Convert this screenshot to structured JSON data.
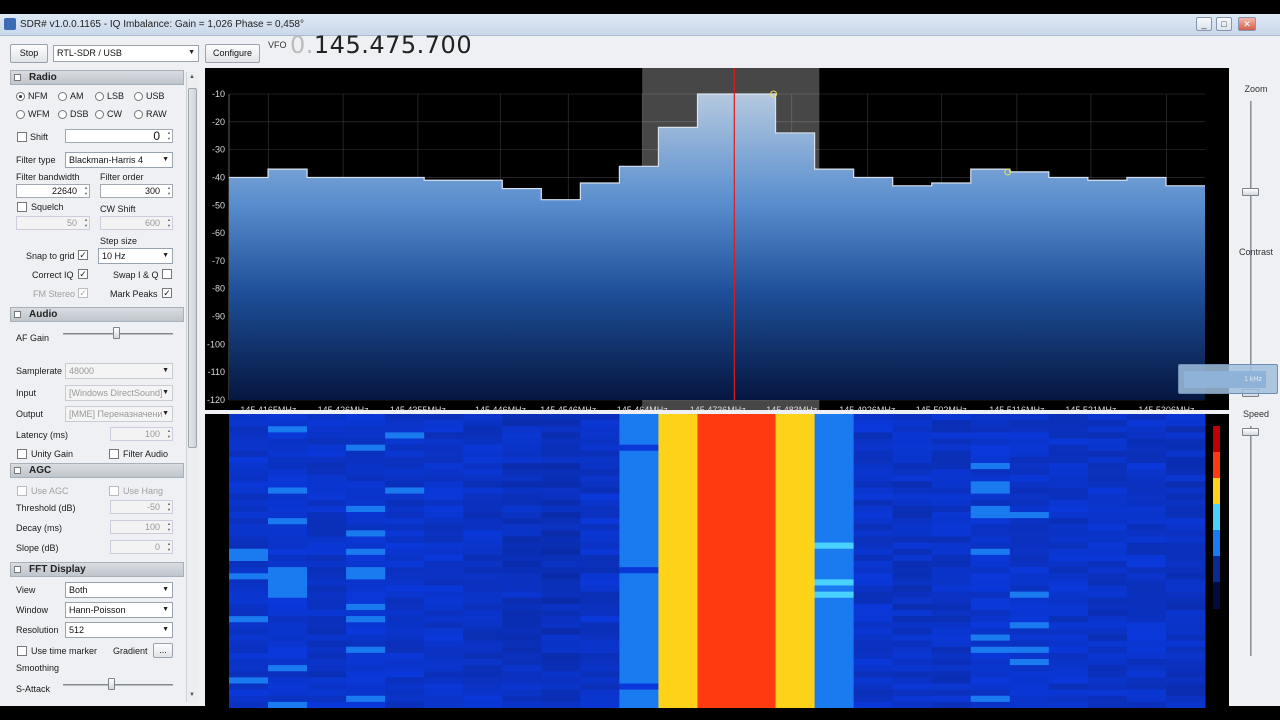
{
  "window": {
    "title": "SDR# v1.0.0.1165 - IQ Imbalance: Gain = 1,026 Phase = 0,458°"
  },
  "toolbar": {
    "stop_label": "Stop",
    "device": "RTL-SDR / USB",
    "configure_label": "Configure",
    "vfo_label": "VFO",
    "vfo_prefix": "0.",
    "vfo_value": "145.475.700"
  },
  "radio": {
    "title": "Radio",
    "modes_row1": [
      "NFM",
      "AM",
      "LSB",
      "USB"
    ],
    "modes_row2": [
      "WFM",
      "DSB",
      "CW",
      "RAW"
    ],
    "selected_mode": "NFM",
    "shift_label": "Shift",
    "shift_value": "0",
    "filter_type_label": "Filter type",
    "filter_type": "Blackman-Harris 4",
    "filter_bandwidth_label": "Filter bandwidth",
    "filter_bandwidth": "22640",
    "filter_order_label": "Filter order",
    "filter_order": "300",
    "squelch_label": "Squelch",
    "squelch_value": "50",
    "cw_shift_label": "CW Shift",
    "cw_shift_value": "600",
    "step_size_label": "Step size",
    "step_size": "10 Hz",
    "snap_label": "Snap to grid",
    "correct_iq_label": "Correct IQ",
    "swap_iq_label": "Swap I & Q",
    "fm_stereo_label": "FM Stereo",
    "mark_peaks_label": "Mark Peaks"
  },
  "audio": {
    "title": "Audio",
    "af_gain_label": "AF Gain",
    "af_gain_level": 0.9,
    "samplerate_label": "Samplerate",
    "samplerate": "48000",
    "input_label": "Input",
    "input": "[Windows DirectSound]",
    "output_label": "Output",
    "output": "[MME] Переназначени",
    "latency_label": "Latency (ms)",
    "latency": "100",
    "unity_gain_label": "Unity Gain",
    "filter_audio_label": "Filter Audio"
  },
  "agc": {
    "title": "AGC",
    "use_agc_label": "Use AGC",
    "use_hang_label": "Use Hang",
    "threshold_label": "Threshold (dB)",
    "threshold": "-50",
    "decay_label": "Decay (ms)",
    "decay": "100",
    "slope_label": "Slope (dB)",
    "slope": "0"
  },
  "fft": {
    "title": "FFT Display",
    "view_label": "View",
    "view": "Both",
    "window_label": "Window",
    "window": "Hann-Poisson",
    "resolution_label": "Resolution",
    "resolution": "512",
    "time_marker_label": "Use time marker",
    "gradient_label": "Gradient",
    "gradient_btn": "...",
    "smoothing_label": "Smoothing",
    "s_attack_label": "S-Attack"
  },
  "right": {
    "zoom_label": "Zoom",
    "contrast_label": "Contrast",
    "speed_label": "Speed",
    "overlay_text": "1 kHz"
  },
  "chart_data": {
    "type": "area",
    "title": "",
    "xlabel": "",
    "ylabel": "",
    "ylim": [
      -120,
      -5
    ],
    "y_ticks": [
      -10,
      -20,
      -30,
      -40,
      -50,
      -60,
      -70,
      -80,
      -90,
      -100,
      -110,
      -120
    ],
    "x_ticks": [
      "145,4165MHz",
      "145,426MHz",
      "145,4355MHz",
      "145,446MHz",
      "145,4546MHz",
      "145,464MHz",
      "145,4736MHz",
      "145,483MHz",
      "145,4926MHz",
      "145,502MHz",
      "145,5116MHz",
      "145,521MHz",
      "145,5306MHz"
    ],
    "x_tick_values": [
      145.4165,
      145.426,
      145.4355,
      145.446,
      145.4546,
      145.464,
      145.4736,
      145.483,
      145.4926,
      145.502,
      145.5116,
      145.521,
      145.5306
    ],
    "x_range": [
      145.4115,
      145.5355
    ],
    "bins": [
      -40,
      -37,
      -40,
      -40,
      -40,
      -41,
      -41,
      -44,
      -48,
      -42,
      -36,
      -22,
      -10,
      -10,
      -24,
      -37,
      -40,
      -43,
      -42,
      -37,
      -38,
      -40,
      -41,
      -40,
      -43
    ],
    "vfo_marker": 145.4757,
    "filter_band": [
      145.464,
      145.4865
    ],
    "peak_markers": [
      -10,
      -38
    ],
    "waterfall_bin_intensity": [
      0.28,
      0.3,
      0.27,
      0.29,
      0.28,
      0.27,
      0.26,
      0.24,
      0.22,
      0.27,
      0.38,
      0.72,
      0.95,
      0.95,
      0.7,
      0.4,
      0.27,
      0.25,
      0.26,
      0.29,
      0.28,
      0.27,
      0.26,
      0.27,
      0.25
    ]
  }
}
